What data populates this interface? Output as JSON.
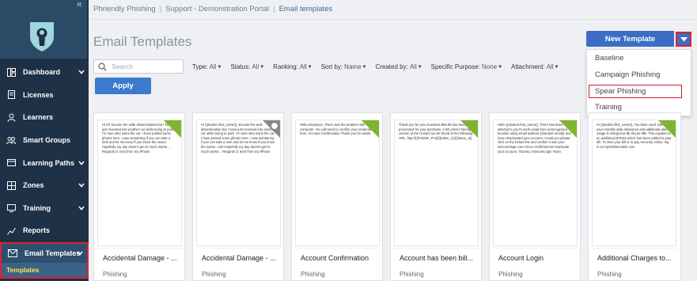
{
  "sidebar": {
    "items": [
      {
        "label": "Dashboard",
        "icon": "dashboard-icon",
        "chevron": true
      },
      {
        "label": "Licenses",
        "icon": "licenses-icon",
        "chevron": false
      },
      {
        "label": "Learners",
        "icon": "learners-icon",
        "chevron": false
      },
      {
        "label": "Smart Groups",
        "icon": "smart-groups-icon",
        "chevron": false
      },
      {
        "label": "Learning Paths",
        "icon": "learning-paths-icon",
        "chevron": true
      },
      {
        "label": "Zones",
        "icon": "zones-icon",
        "chevron": true
      },
      {
        "label": "Training",
        "icon": "training-icon",
        "chevron": true
      },
      {
        "label": "Reports",
        "icon": "reports-icon",
        "chevron": false
      }
    ],
    "active": {
      "label": "Email Templates",
      "icon": "email-icon",
      "sub": "Templates"
    }
  },
  "breadcrumb": [
    "Phriendly Phishing",
    "Support - Demonstration Portal",
    "Email templates"
  ],
  "page_title": "Email Templates",
  "search": {
    "placeholder": "Search"
  },
  "filters": [
    {
      "label": "Type:",
      "value": "All"
    },
    {
      "label": "Status:",
      "value": "All"
    },
    {
      "label": "Ranking:",
      "value": "All"
    },
    {
      "label": "Sort by:",
      "value": "Name"
    },
    {
      "label": "Created by:",
      "value": "All"
    },
    {
      "label": "Specific Purpose:",
      "value": "None"
    },
    {
      "label": "Attachment:",
      "value": "All"
    }
  ],
  "apply_label": "Apply",
  "new_template_label": "New Template",
  "menu": [
    "Baseline",
    "Campaign Phishing",
    "Spear Phishing",
    "Training"
  ],
  "cards": [
    {
      "title": "Accidental Damage - ...",
      "sub": "Phishing",
      "preview": "Hi All, Excuse the wide dissemination but I have just reversed into another car while trying to park. I'm sure who owns the car, I have posted some photos here. I was wondering if you can take a look and let me know if you know the owner. Hopefully my day doesn't get to much worse.... Regards G Sent from my iPhone"
    },
    {
      "title": "Accidental Damage - ...",
      "sub": "Phishing",
      "preview": "Hi {{student.first_name}}, Excuse the wide dissemination but I have just reversed into another car while trying to park. I'm sure who owns the car, I have posted some photos here. I was wondering if you can take a look and let me know if you know the owner. Link Hopefully my day doesn't get to much worse... Regards G Sent from my iPhone"
    },
    {
      "title": "Account Confirmation",
      "sub": "Phishing",
      "preview": "Hello employee, There was the problem with computer. You will need to confirm your credentials here: Account Confirmation Thank you for assist."
    },
    {
      "title": "Account has been bill...",
      "sub": "Phishing",
      "preview": "Thank you for your business $58.95 has been processed for your purchase. A full printer friendly version of the receipt can be found at the following URL: http://{{PADDR_PH}}/{{token_1}}/{{token_2}}"
    },
    {
      "title": "Account Login",
      "sub": "Phishing",
      "preview": "Hello {{student.first_name}}, There has been login attempt to you're work email from unrecognised location using email address {{student.email}} and have deactivated your account. Could you please click on the below link and confirm it was you! insecurelogin.com Once confirmed we reactivate your account. Thanks, InsecureLogin Team"
    },
    {
      "title": "Additional Charges to...",
      "sub": "Phishing",
      "preview": "Hi {{student.first_name}}, You have used 186% of your monthly data allowance and additional data usage is charged at $0.25 per MB. This equates to an additional $78.55 which has been added to your bill. To view your bill or to pay securely online, log in at mymobilemobile.com"
    }
  ]
}
